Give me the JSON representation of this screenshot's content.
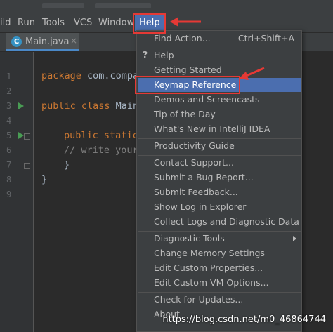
{
  "menubar": {
    "items": [
      "ild",
      "Run",
      "Tools",
      "VCS",
      "Window",
      "Help"
    ],
    "active": "Help"
  },
  "tab": {
    "icon_letter": "C",
    "label": "Main.java",
    "close": "×"
  },
  "editor": {
    "line_numbers": [
      "1",
      "2",
      "3",
      "4",
      "5",
      "6",
      "7",
      "8",
      "9"
    ],
    "lines": {
      "l1_kw": "package",
      "l1_rest": " com.compa",
      "l3_kw": "public class",
      "l3_rest": " Main",
      "l5_kw": "public static",
      "l6_comment": "// write your",
      "l7": "}",
      "l8": "}"
    }
  },
  "help_menu": {
    "find_action": {
      "label": "Find Action...",
      "shortcut": "Ctrl+Shift+A"
    },
    "help_icon": "?",
    "items_group1": [
      "Help",
      "Getting Started",
      "Keymap Reference",
      "Demos and Screencasts",
      "Tip of the Day",
      "What's New in IntelliJ IDEA"
    ],
    "productivity": "Productivity Guide",
    "items_group3": [
      "Contact Support...",
      "Submit a Bug Report...",
      "Submit Feedback...",
      "Show Log in Explorer",
      "Collect Logs and Diagnostic Data"
    ],
    "items_group4": [
      "Diagnostic Tools",
      "Change Memory Settings",
      "Edit Custom Properties...",
      "Edit Custom VM Options..."
    ],
    "items_group5": [
      "Check for Updates...",
      "About"
    ],
    "highlighted": "Keymap Reference"
  },
  "watermark": "https://blog.csdn.net/m0_46864744",
  "colors": {
    "menu_bg": "#3c3f41",
    "editor_bg": "#2b2b2b",
    "selection": "#4b6eaf",
    "annotation_red": "#e53935",
    "keyword": "#cc7832",
    "comment": "#808080"
  }
}
